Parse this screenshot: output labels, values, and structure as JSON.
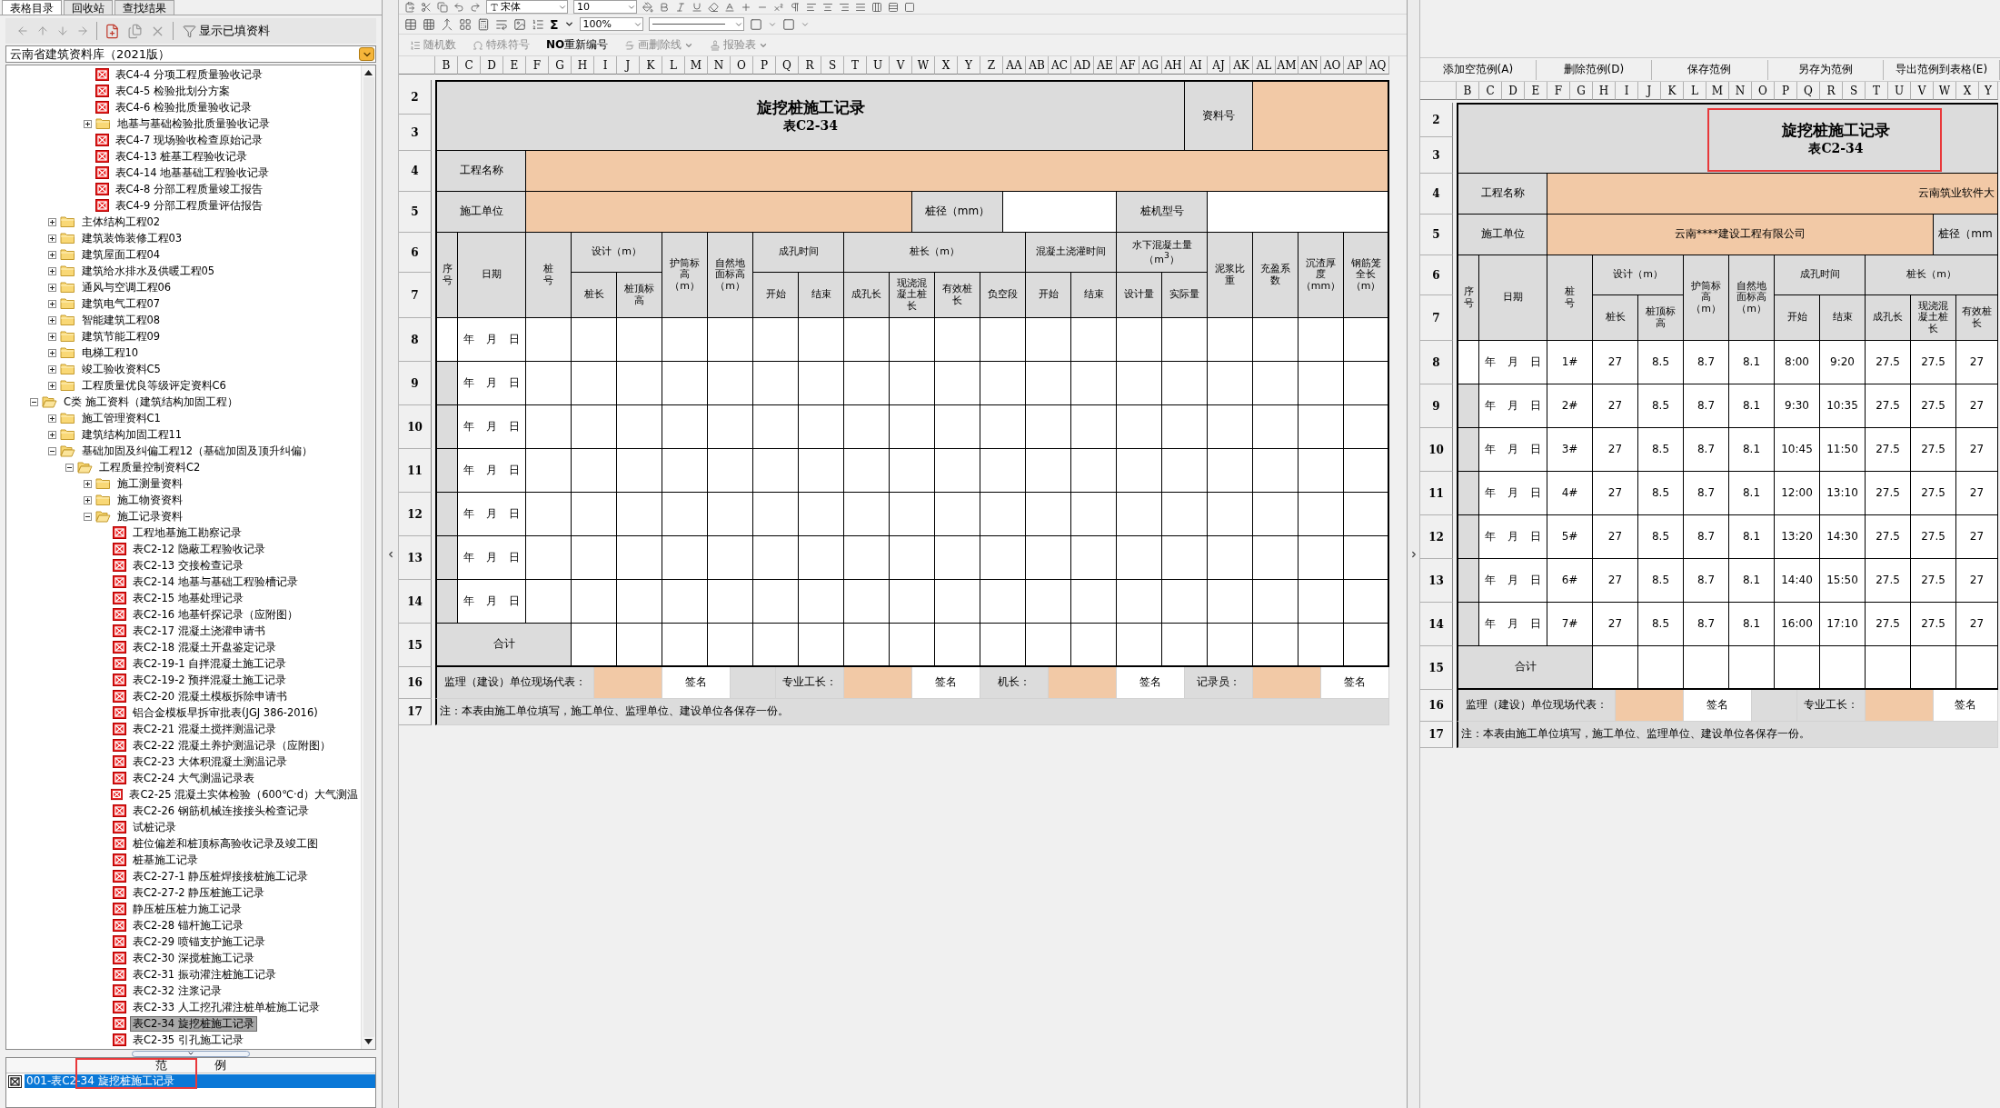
{
  "left_panel": {
    "tabs": [
      {
        "label": "表格目录",
        "selected": true
      },
      {
        "label": "回收站",
        "selected": false
      },
      {
        "label": "查找结果",
        "selected": false
      }
    ],
    "toolbar": {
      "filter_label": "显示已填资料"
    },
    "library": {
      "value": "云南省建筑资料库（2021版）"
    },
    "tree": [
      {
        "kind": "offscreen",
        "children": [
          {
            "kind": "offscreen",
            "children": [
              {
                "kind": "offscreen",
                "children": [
                  {
                    "label": "表C4-4 分项工程质量验收记录",
                    "kind": "file",
                    "selected": false
                  },
                  {
                    "label": "表C4-5 检验批划分方案",
                    "kind": "file",
                    "selected": false
                  },
                  {
                    "label": "表C4-6 检验批质量验收记录",
                    "kind": "file",
                    "selected": false
                  },
                  {
                    "label": "地基与基础检验批质量验收记录",
                    "kind": "folder",
                    "expanded": false,
                    "selected": false
                  },
                  {
                    "label": "表C4-7 现场验收检查原始记录",
                    "kind": "file",
                    "selected": false
                  },
                  {
                    "label": "表C4-13 桩基工程验收记录",
                    "kind": "file",
                    "selected": false
                  },
                  {
                    "label": "表C4-14 地基基础工程验收记录",
                    "kind": "file",
                    "selected": false
                  },
                  {
                    "label": "表C4-8 分部工程质量竣工报告",
                    "kind": "file",
                    "selected": false
                  },
                  {
                    "label": "表C4-9 分部工程质量评估报告",
                    "kind": "file",
                    "selected": false
                  }
                ]
              }
            ]
          },
          {
            "label": "主体结构工程02",
            "kind": "folder",
            "expanded": false,
            "selected": false
          },
          {
            "label": "建筑装饰装修工程03",
            "kind": "folder",
            "expanded": false,
            "selected": false
          },
          {
            "label": "建筑屋面工程04",
            "kind": "folder",
            "expanded": false,
            "selected": false
          },
          {
            "label": "建筑给水排水及供暖工程05",
            "kind": "folder",
            "expanded": false,
            "selected": false
          },
          {
            "label": "通风与空调工程06",
            "kind": "folder",
            "expanded": false,
            "selected": false
          },
          {
            "label": "建筑电气工程07",
            "kind": "folder",
            "expanded": false,
            "selected": false
          },
          {
            "label": "智能建筑工程08",
            "kind": "folder",
            "expanded": false,
            "selected": false
          },
          {
            "label": "建筑节能工程09",
            "kind": "folder",
            "expanded": false,
            "selected": false
          },
          {
            "label": "电梯工程10",
            "kind": "folder",
            "expanded": false,
            "selected": false
          },
          {
            "label": "竣工验收资料C5",
            "kind": "folder",
            "expanded": false,
            "selected": false
          },
          {
            "label": "工程质量优良等级评定资料C6",
            "kind": "folder",
            "expanded": false,
            "selected": false
          }
        ]
      },
      {
        "label": "C类 施工资料（建筑结构加固工程）",
        "kind": "folder",
        "expanded": true,
        "selected": false,
        "children": [
          {
            "label": "施工管理资料C1",
            "kind": "folder",
            "expanded": false,
            "selected": false
          },
          {
            "label": "建筑结构加固工程11",
            "kind": "folder",
            "expanded": false,
            "selected": false
          },
          {
            "label": "基础加固及纠偏工程12（基础加固及顶升纠偏）",
            "kind": "folder",
            "expanded": true,
            "selected": false,
            "children": [
              {
                "label": "工程质量控制资料C2",
                "kind": "folder",
                "expanded": true,
                "selected": false,
                "children": [
                  {
                    "label": "施工测量资料",
                    "kind": "folder",
                    "expanded": false,
                    "selected": false
                  },
                  {
                    "label": "施工物资资料",
                    "kind": "folder",
                    "expanded": false,
                    "selected": false
                  },
                  {
                    "label": "施工记录资料",
                    "kind": "folder",
                    "expanded": true,
                    "selected": false,
                    "children": [
                      {
                        "label": "工程地基施工勘察记录",
                        "kind": "file",
                        "selected": false
                      },
                      {
                        "label": "表C2-12 隐蔽工程验收记录",
                        "kind": "file",
                        "selected": false
                      },
                      {
                        "label": "表C2-13 交接检查记录",
                        "kind": "file",
                        "selected": false
                      },
                      {
                        "label": "表C2-14 地基与基础工程验槽记录",
                        "kind": "file",
                        "selected": false
                      },
                      {
                        "label": "表C2-15 地基处理记录",
                        "kind": "file",
                        "selected": false
                      },
                      {
                        "label": "表C2-16 地基钎探记录（应附图）",
                        "kind": "file",
                        "selected": false
                      },
                      {
                        "label": "表C2-17 混凝土浇灌申请书",
                        "kind": "file",
                        "selected": false
                      },
                      {
                        "label": "表C2-18 混凝土开盘鉴定记录",
                        "kind": "file",
                        "selected": false
                      },
                      {
                        "label": "表C2-19-1 自拌混凝土施工记录",
                        "kind": "file",
                        "selected": false
                      },
                      {
                        "label": "表C2-19-2 预拌混凝土施工记录",
                        "kind": "file",
                        "selected": false
                      },
                      {
                        "label": "表C2-20 混凝土模板拆除申请书",
                        "kind": "file",
                        "selected": false
                      },
                      {
                        "label": "铝合金模板早拆审批表(JGJ 386-2016)",
                        "kind": "file",
                        "selected": false
                      },
                      {
                        "label": "表C2-21 混凝土搅拌测温记录",
                        "kind": "file",
                        "selected": false
                      },
                      {
                        "label": "表C2-22 混凝土养护测温记录（应附图）",
                        "kind": "file",
                        "selected": false
                      },
                      {
                        "label": "表C2-23 大体积混凝土测温记录",
                        "kind": "file",
                        "selected": false
                      },
                      {
                        "label": "表C2-24 大气测温记录表",
                        "kind": "file",
                        "selected": false
                      },
                      {
                        "label": "表C2-25 混凝土实体检验（600℃·d）大气测温",
                        "kind": "file",
                        "selected": false
                      },
                      {
                        "label": "表C2-26 钢筋机械连接接头检查记录",
                        "kind": "file",
                        "selected": false
                      },
                      {
                        "label": "试桩记录",
                        "kind": "file",
                        "selected": false
                      },
                      {
                        "label": "桩位偏差和桩顶标高验收记录及竣工图",
                        "kind": "file",
                        "selected": false
                      },
                      {
                        "label": "桩基施工记录",
                        "kind": "file",
                        "selected": false
                      },
                      {
                        "label": "表C2-27-1 静压桩焊接接桩施工记录",
                        "kind": "file",
                        "selected": false
                      },
                      {
                        "label": "表C2-27-2 静压桩施工记录",
                        "kind": "file",
                        "selected": false
                      },
                      {
                        "label": "静压桩压桩力施工记录",
                        "kind": "file",
                        "selected": false
                      },
                      {
                        "label": "表C2-28 锚杆施工记录",
                        "kind": "file",
                        "selected": false
                      },
                      {
                        "label": "表C2-29 喷锚支护施工记录",
                        "kind": "file",
                        "selected": false
                      },
                      {
                        "label": "表C2-30 深搅桩施工记录",
                        "kind": "file",
                        "selected": false
                      },
                      {
                        "label": "表C2-31 振动灌注桩施工记录",
                        "kind": "file",
                        "selected": false
                      },
                      {
                        "label": "表C2-32 注浆记录",
                        "kind": "file",
                        "selected": false
                      },
                      {
                        "label": "表C2-33 人工挖孔灌注桩单桩施工记录",
                        "kind": "file",
                        "selected": false
                      },
                      {
                        "label": "表C2-34 旋挖桩施工记录",
                        "kind": "file",
                        "selected": true
                      },
                      {
                        "label": "表C2-35 引孔施工记录",
                        "kind": "file",
                        "selected": false
                      }
                    ]
                  }
                ]
              }
            ]
          }
        ]
      }
    ],
    "examples": {
      "header": "范　　　　例",
      "items": [
        {
          "label": "001-表C2-34 旋挖桩施工记录",
          "selected": true,
          "highlighted": true
        }
      ]
    }
  },
  "editor": {
    "toolbar": {
      "font": "宋体",
      "size": "10",
      "sum": "Σ",
      "zoom": "100%",
      "tools": [
        {
          "label": "随机数",
          "disabled": true
        },
        {
          "label": "特殊符号",
          "disabled": true
        },
        {
          "label": "**NO**重新编号",
          "disabled": false
        },
        {
          "label": "画删除线",
          "disabled": true,
          "menu": true
        },
        {
          "label": "报验表",
          "disabled": true,
          "menu": true
        }
      ]
    },
    "sheet": {
      "columns": [
        "B",
        "C",
        "D",
        "E",
        "F",
        "G",
        "H",
        "I",
        "J",
        "K",
        "L",
        "M",
        "N",
        "O",
        "P",
        "Q",
        "R",
        "S",
        "T",
        "U",
        "V",
        "W",
        "X",
        "Y",
        "Z",
        "AA",
        "AB",
        "AC",
        "AD",
        "AE",
        "AF",
        "AG",
        "AH",
        "AI",
        "AJ",
        "AK",
        "AL",
        "AM",
        "AN",
        "AO",
        "AP",
        "AQ"
      ],
      "rows": [
        "2",
        "3",
        "4",
        "5",
        "6",
        "7",
        "8",
        "9",
        "10",
        "11",
        "12",
        "13",
        "14",
        "15",
        "16",
        "17"
      ]
    },
    "form": {
      "title": "旋挖桩施工记录",
      "number": "表C2-34",
      "doc_no_label": "资料号",
      "project_label": "工程名称",
      "unit_label": "施工单位",
      "diameter_label": "桩径（mm）",
      "rig_label": "桩机型号",
      "headers": [
        "序号",
        "日期",
        "桩号",
        "设计（m）",
        "护筒标高（m）",
        "自然地面标高（m）",
        "成孔时间",
        "桩长（m）",
        "混凝土浇灌时间",
        "水下混凝土量（m$^{3}$）",
        "泥浆比重",
        "充盈系数",
        "沉渣厚度（mm）",
        "钢筋笼全长（m）"
      ],
      "subheaders": [
        "桩长",
        "桩顶标高",
        "开始",
        "结束",
        "成孔长",
        "现浇混凝土桩长",
        "有效桩长",
        "负空段",
        "开始",
        "结束",
        "设计量",
        "实际量"
      ],
      "rows": [
        {
          "shaded": false,
          "date": "年 月 日"
        },
        {
          "shaded": true,
          "date": "年 月 日"
        },
        {
          "shaded": true,
          "date": "年 月 日"
        },
        {
          "shaded": true,
          "date": "年 月 日"
        },
        {
          "shaded": true,
          "date": "年 月 日"
        },
        {
          "shaded": true,
          "date": "年 月 日"
        },
        {
          "shaded": true,
          "date": "年 月 日"
        }
      ],
      "total_label": "合计",
      "signatures": [
        {
          "kind": "label",
          "text": "监理（建设）单位现场代表："
        },
        {
          "kind": "fill"
        },
        {
          "kind": "sign",
          "text": "签名"
        },
        {
          "kind": "blank"
        },
        {
          "kind": "label",
          "text": "专业工长："
        },
        {
          "kind": "fill"
        },
        {
          "kind": "sign",
          "text": "签名"
        },
        {
          "kind": "label",
          "text": "机长："
        },
        {
          "kind": "fill"
        },
        {
          "kind": "sign",
          "text": "签名"
        },
        {
          "kind": "label",
          "text": "记录员："
        },
        {
          "kind": "fill"
        },
        {
          "kind": "sign",
          "text": "签名"
        }
      ],
      "note": "注：本表由施工单位填写，施工单位、监理单位、建设单位各保存一份。"
    }
  },
  "example_panel": {
    "buttons": [
      "添加空范例(A)",
      "删除范例(D)",
      "保存范例",
      "另存为范例",
      "导出范例到表格(E)"
    ],
    "sheet": {
      "columns": [
        "B",
        "C",
        "D",
        "E",
        "F",
        "G",
        "H",
        "I",
        "J",
        "K",
        "L",
        "M",
        "N",
        "O",
        "P",
        "Q",
        "R",
        "S",
        "T",
        "U",
        "V",
        "W",
        "X",
        "Y"
      ],
      "rows": [
        "2",
        "3",
        "4",
        "5",
        "6",
        "7",
        "8",
        "9",
        "10",
        "11",
        "12",
        "13",
        "14",
        "15",
        "16",
        "17"
      ]
    },
    "form": {
      "title": "旋挖桩施工记录",
      "number": "表C2-34",
      "title_highlighted": true,
      "project_label": "工程名称",
      "project_value": "云南筑业软件大",
      "unit_label": "施工单位",
      "unit_value": "云南****建设工程有限公司",
      "diameter_label": "桩径（mm",
      "headers": [
        "序号",
        "日期",
        "桩号",
        "设计（m）",
        "护筒标高（m）",
        "自然地面标高（m）",
        "成孔时间",
        "桩长（m）"
      ],
      "subheaders": [
        "桩长",
        "桩顶标高",
        "开始",
        "结束",
        "成孔长",
        "现浇混凝土桩长",
        "有效桩长"
      ],
      "rows": [
        {
          "shaded": false,
          "date": "年 月 日",
          "pile": "1#",
          "values": [
            "27",
            "8.5",
            "8.7",
            "8.1",
            "8:00",
            "9:20",
            "27.5",
            "27.5",
            "27"
          ]
        },
        {
          "shaded": true,
          "date": "年 月 日",
          "pile": "2#",
          "values": [
            "27",
            "8.5",
            "8.7",
            "8.1",
            "9:30",
            "10:35",
            "27.5",
            "27.5",
            "27"
          ]
        },
        {
          "shaded": true,
          "date": "年 月 日",
          "pile": "3#",
          "values": [
            "27",
            "8.5",
            "8.7",
            "8.1",
            "10:45",
            "11:50",
            "27.5",
            "27.5",
            "27"
          ]
        },
        {
          "shaded": true,
          "date": "年 月 日",
          "pile": "4#",
          "values": [
            "27",
            "8.5",
            "8.7",
            "8.1",
            "12:00",
            "13:10",
            "27.5",
            "27.5",
            "27"
          ]
        },
        {
          "shaded": true,
          "date": "年 月 日",
          "pile": "5#",
          "values": [
            "27",
            "8.5",
            "8.7",
            "8.1",
            "13:20",
            "14:30",
            "27.5",
            "27.5",
            "27"
          ]
        },
        {
          "shaded": true,
          "date": "年 月 日",
          "pile": "6#",
          "values": [
            "27",
            "8.5",
            "8.7",
            "8.1",
            "14:40",
            "15:50",
            "27.5",
            "27.5",
            "27"
          ]
        },
        {
          "shaded": true,
          "date": "年 月 日",
          "pile": "7#",
          "values": [
            "27",
            "8.5",
            "8.7",
            "8.1",
            "16:00",
            "17:10",
            "27.5",
            "27.5",
            "27"
          ]
        }
      ],
      "total_label": "合计",
      "signatures": [
        {
          "kind": "label",
          "text": "监理（建设）单位现场代表："
        },
        {
          "kind": "fill"
        },
        {
          "kind": "sign",
          "text": "签名"
        },
        {
          "kind": "blank"
        },
        {
          "kind": "label",
          "text": "专业工长："
        },
        {
          "kind": "fill"
        },
        {
          "kind": "sign",
          "text": "签名"
        }
      ],
      "note": "注：本表由施工单位填写，施工单位、监理单位、建设单位各保存一份。"
    }
  }
}
